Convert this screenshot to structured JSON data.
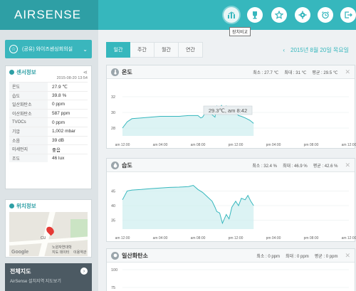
{
  "header": {
    "logo": "AIRSENSE",
    "tooltip": "장치비교",
    "icons": [
      "devices-icon",
      "trophy-icon",
      "star-icon",
      "gear-icon",
      "alarm-icon",
      "logout-icon"
    ]
  },
  "sidebar": {
    "space": "(공유) 와이즈센싱회의실",
    "sensor_panel": {
      "title": "센서정보",
      "time": "2015-08-20 13:54",
      "rows": [
        {
          "name": "온도",
          "value": "27.9 ℃"
        },
        {
          "name": "습도",
          "value": "39.8 %"
        },
        {
          "name": "일산화탄소",
          "value": "0 ppm"
        },
        {
          "name": "이산화탄소",
          "value": "587 ppm"
        },
        {
          "name": "TVOCs",
          "value": "0 ppm"
        },
        {
          "name": "기압",
          "value": "1,002 mbar"
        },
        {
          "name": "소음",
          "value": "39 dB"
        },
        {
          "name": "미세먼지",
          "value": "좋음"
        },
        {
          "name": "조도",
          "value": "46 lux"
        }
      ]
    },
    "location_panel": {
      "title": "위치정보",
      "map_labels": {
        "google": "Google",
        "cu": "CU",
        "place": "노원자연대학",
        "footer1": "지도 데이터",
        "footer2": "이용약관"
      }
    },
    "full_map": {
      "title": "전체지도",
      "subtitle": "AirSense 설치지역 지도보기"
    }
  },
  "main": {
    "tabs": [
      "일간",
      "주간",
      "월간",
      "연간"
    ],
    "active_tab": "일간",
    "date": "2015년 8월 20일 목요일",
    "cards": [
      {
        "title": "온도",
        "stats": {
          "min": "최소 : 27.7 ℃",
          "max": "최대 : 31 ℃",
          "avg": "평균 : 29.5 ℃"
        }
      },
      {
        "title": "습도",
        "stats": {
          "min": "최소 : 32.4 %",
          "max": "최대 : 46.9 %",
          "avg": "평균 : 42.6 %"
        }
      },
      {
        "title": "일산화탄소",
        "stats": {
          "min": "최소 : 0 ppm",
          "max": "최대 : 0 ppm",
          "avg": "평균 : 0 ppm"
        }
      }
    ],
    "tooltip_value": "29.3℃, am 8:42"
  },
  "chart_data": [
    {
      "type": "area",
      "name": "온도",
      "x_ticks": [
        "am 12:00",
        "am 04:00",
        "am 08:00",
        "pm 12:00",
        "pm 04:00",
        "pm 08:00",
        "am 12:00"
      ],
      "y_ticks": [
        32,
        30,
        28
      ],
      "ylim": [
        27,
        33
      ],
      "x_hours": [
        0,
        0.5,
        1,
        2,
        3,
        4,
        5,
        6,
        7,
        7.5,
        8,
        8.3,
        8.5,
        8.7,
        9,
        9.2,
        9.5,
        9.8,
        10,
        10.2,
        10.5,
        10.8,
        11,
        11.2,
        11.5,
        11.8,
        12,
        12.3,
        12.6,
        13,
        13.5,
        13.9
      ],
      "values": [
        28.0,
        28.8,
        29.2,
        29.3,
        29.4,
        29.5,
        29.5,
        29.5,
        29.6,
        29.6,
        29.6,
        29.3,
        29.4,
        29.8,
        30.2,
        30.0,
        29.7,
        29.4,
        30.8,
        30.4,
        30.9,
        30.2,
        30.8,
        29.9,
        30.4,
        29.8,
        30.0,
        29.6,
        29.5,
        29.3,
        29.0,
        28.6
      ]
    },
    {
      "type": "area",
      "name": "습도",
      "x_ticks": [
        "am 12:00",
        "am 04:00",
        "am 08:00",
        "pm 12:00",
        "pm 04:00",
        "pm 08:00",
        "am 12:00"
      ],
      "y_ticks": [
        45,
        40,
        35
      ],
      "ylim": [
        32,
        48
      ],
      "x_hours": [
        0,
        0.5,
        1,
        2,
        3,
        4,
        5,
        6,
        7,
        7.5,
        8,
        8.5,
        9,
        9.5,
        9.8,
        10,
        10.3,
        10.6,
        11,
        11.3,
        11.6,
        12,
        12.3,
        12.6,
        13,
        13.3,
        13.6,
        13.9
      ],
      "values": [
        42.0,
        45.0,
        45.3,
        45.5,
        45.8,
        46.0,
        46.2,
        46.3,
        46.5,
        46.9,
        45.5,
        44.5,
        43.0,
        41.5,
        39.5,
        38.0,
        37.5,
        34.0,
        37.0,
        35.5,
        39.5,
        41.5,
        40.0,
        42.5,
        42.0,
        43.5,
        41.5,
        40.0
      ]
    },
    {
      "type": "area",
      "name": "일산화탄소",
      "y_ticks": [
        100,
        75
      ],
      "ylim": [
        0,
        100
      ]
    }
  ]
}
